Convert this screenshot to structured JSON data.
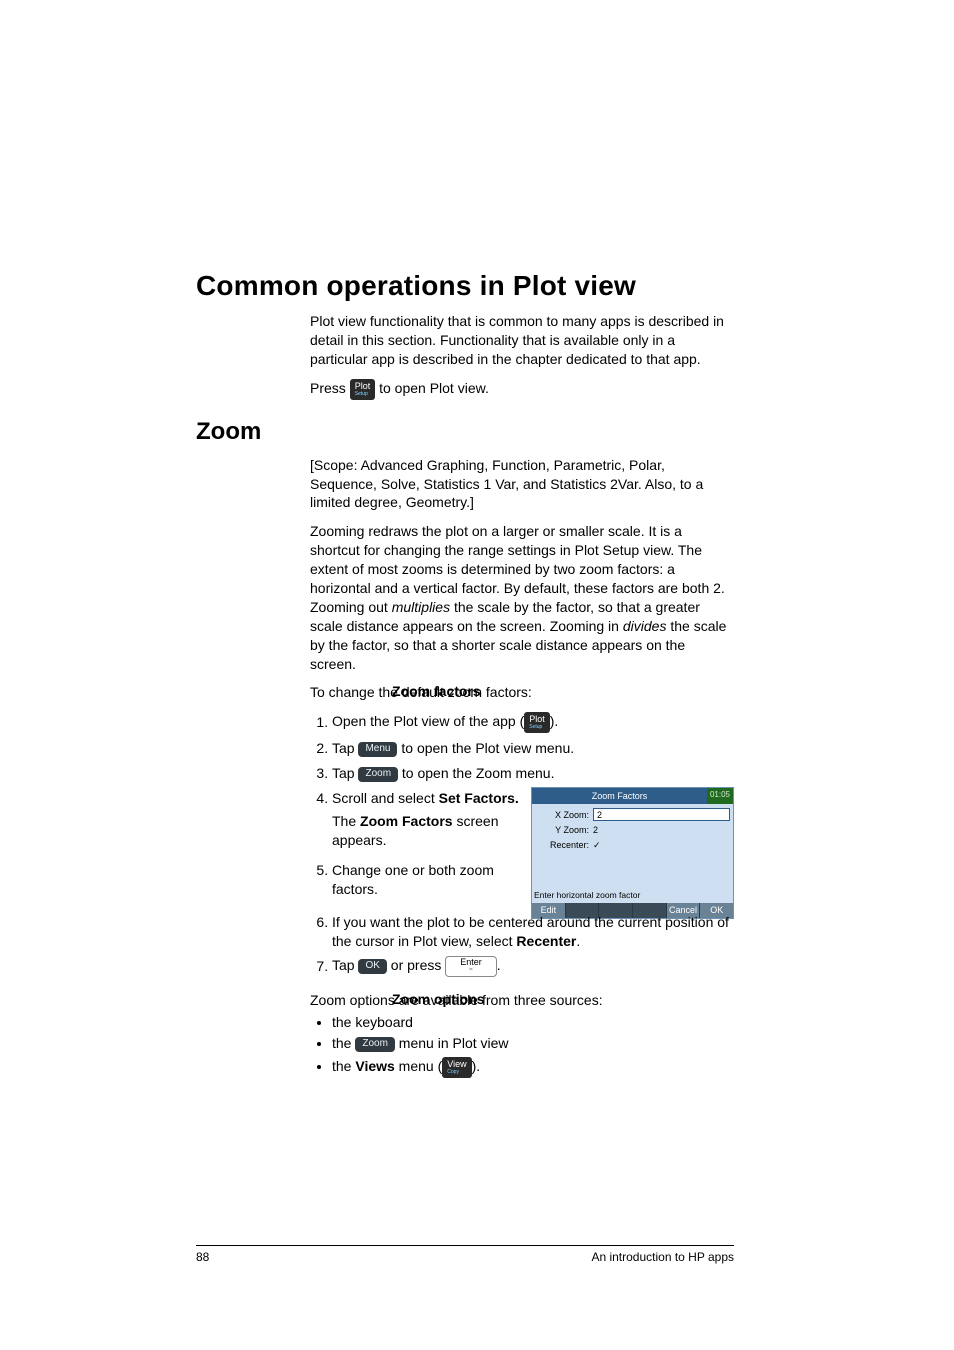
{
  "h1": "Common operations in Plot view",
  "intro1": "Plot view functionality that is common to many apps is described in detail in this section. Functionality that is available only in a particular app is described in the chapter dedicated to that app.",
  "intro2_a": "Press ",
  "intro2_b": " to open Plot view.",
  "key_plot_top": "Plot",
  "key_plot_sub": "Setup",
  "h2_zoom": "Zoom",
  "zoom_scope": "[Scope: Advanced Graphing, Function, Parametric, Polar, Sequence, Solve, Statistics 1 Var, and Statistics 2Var. Also, to a limited degree, Geometry.]",
  "zoom_para_a": "Zooming redraws the plot on a larger or smaller scale. It is a shortcut for changing the range settings in Plot Setup view. The extent of most zooms is determined by two zoom factors: a horizontal and a vertical factor. By default, these factors are both 2. Zooming out ",
  "zoom_para_mult": "multiplies",
  "zoom_para_b": " the scale by the factor, so that a greater scale distance appears on the screen. Zooming in ",
  "zoom_para_div": "divides",
  "zoom_para_c": " the scale by the factor, so that a shorter scale distance appears on the screen.",
  "side_zoom_factors": "Zoom factors",
  "zf_intro": "To change the default zoom factors:",
  "step1_a": "Open the Plot view of the app (",
  "step1_b": ").",
  "step2_a": "Tap ",
  "step2_b": " to open the Plot view menu.",
  "softkey_menu": "Menu",
  "step3_a": "Tap ",
  "step3_b": " to open the Zoom menu.",
  "softkey_zoom": "Zoom",
  "step4_a": "Scroll and select ",
  "step4_bold": "Set Factors.",
  "step4_sub_a": "The ",
  "step4_sub_bold": "Zoom Factors",
  "step4_sub_b": " screen appears.",
  "step5": "Change one or both zoom factors.",
  "step6_a": "If you want the plot to be centered around the current position of the cursor in Plot view, select ",
  "step6_bold": "Recenter",
  "step6_b": ".",
  "step7_a": "Tap ",
  "step7_b": " or press ",
  "step7_c": ".",
  "softkey_ok": "OK",
  "key_enter": "Enter",
  "key_enter_sub": "≈",
  "side_zoom_options": "Zoom options",
  "zo_intro": "Zoom options are available from three sources:",
  "zo_b1": "the keyboard",
  "zo_b2_a": "the ",
  "zo_b2_b": " menu in Plot view",
  "zo_b3_a": "the ",
  "zo_b3_bold": "Views",
  "zo_b3_b": " menu (",
  "zo_b3_c": ").",
  "key_view_top": "View",
  "key_view_sub": "Copy",
  "calc": {
    "title": "Zoom Factors",
    "time": "01:05",
    "xzoom_lbl": "X Zoom:",
    "xzoom_val": "2",
    "yzoom_lbl": "Y Zoom:",
    "yzoom_val": "2",
    "recenter_lbl": "Recenter:",
    "recenter_val": "✓",
    "help": "Enter horizontal zoom factor",
    "mk_edit": "Edit",
    "mk_cancel": "Cancel",
    "mk_ok": "OK"
  },
  "footer_page": "88",
  "footer_title": "An introduction to HP apps"
}
